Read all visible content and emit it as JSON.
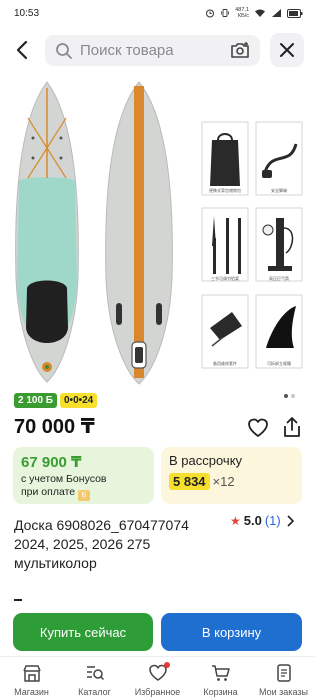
{
  "status_bar": {
    "time": "10:53",
    "net_speed_value": "487,1",
    "net_speed_unit": "КБ/с"
  },
  "search": {
    "placeholder": "Поиск товара"
  },
  "gallery": {
    "captions": [
      "便携式背包储物包",
      "安全脚绳",
      "三节可调节铝桨",
      "高压打气筒",
      "备用维修套件",
      "可拆卸主尾鳍"
    ]
  },
  "badges": {
    "bonus": "2 100 Б",
    "installment": "0•0•24"
  },
  "product": {
    "price": "70 000 ₸",
    "title": "Доска 6908026_670477074 2024, 2025, 2026 275 мультиколор",
    "rating": "5.0",
    "rating_count": "(1)"
  },
  "bonus_card": {
    "price": "67 900 ₸",
    "note_line1": "с учетом Бонусов",
    "note_line2": "при оплате",
    "coin": "Б"
  },
  "installment_card": {
    "title": "В рассрочку",
    "amount": "5 834",
    "months": "×12"
  },
  "actions": {
    "buy_now": "Купить сейчас",
    "add_to_cart": "В корзину"
  },
  "nav": {
    "items": [
      {
        "label": "Магазин",
        "icon": "shop-icon"
      },
      {
        "label": "Каталог",
        "icon": "catalog-search-icon"
      },
      {
        "label": "Избранное",
        "icon": "heart-icon"
      },
      {
        "label": "Корзина",
        "icon": "cart-icon"
      },
      {
        "label": "Мои заказы",
        "icon": "orders-icon"
      }
    ]
  },
  "colors": {
    "green": "#2e9d37",
    "blue": "#1f6fd1",
    "yellow": "#f7e02d",
    "board_mint": "#9fd8c8",
    "board_orange": "#d9892b"
  }
}
